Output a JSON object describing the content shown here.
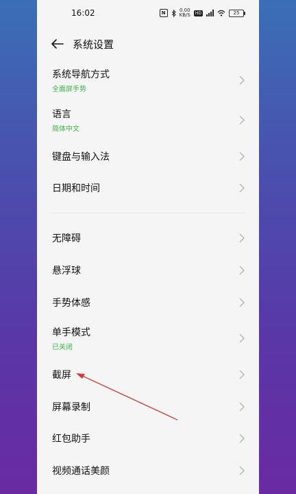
{
  "status": {
    "time": "16:02",
    "nfc": "N",
    "net_speed_top": "0.00",
    "net_speed_bottom": "KB/S",
    "hd": "HD",
    "battery": "25"
  },
  "header": {
    "title": "系统设置"
  },
  "items": [
    {
      "label": "系统导航方式",
      "sub": "全面屏手势"
    },
    {
      "label": "语言",
      "sub": "简体中文"
    },
    {
      "label": "键盘与输入法"
    },
    {
      "label": "日期和时间"
    },
    {
      "label": "无障碍"
    },
    {
      "label": "悬浮球"
    },
    {
      "label": "手势体感"
    },
    {
      "label": "单手模式",
      "sub": "已关闭"
    },
    {
      "label": "截屏"
    },
    {
      "label": "屏幕录制"
    },
    {
      "label": "红包助手"
    },
    {
      "label": "视频通话美颜"
    }
  ],
  "colors": {
    "accent": "#3db24a",
    "annotation_arrow": "#d23a3a"
  }
}
